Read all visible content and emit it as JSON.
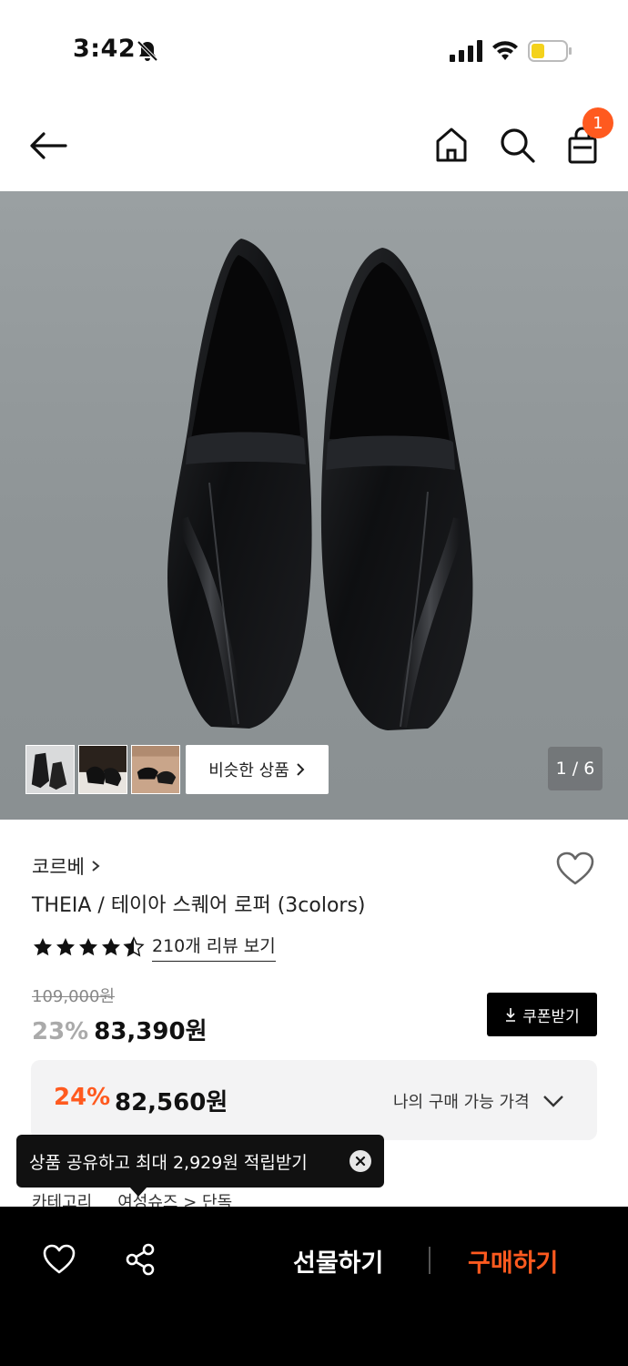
{
  "status": {
    "time": "3:42"
  },
  "header": {
    "cart_count": "1"
  },
  "gallery": {
    "similar_label": "비슷한 상품",
    "page_indicator": "1 / 6"
  },
  "product": {
    "brand": "코르베",
    "name": "THEIA / 테이아 스퀘어 로퍼 (3colors)",
    "rating": 4.5,
    "review_link": "210개 리뷰 보기",
    "original_price": "109,000원",
    "discount": "23%",
    "sale_price": "83,390원",
    "coupon_label": "쿠폰받기"
  },
  "my_price": {
    "discount": "24%",
    "price": "82,560원",
    "label": "나의 구매 가능 가격"
  },
  "category": {
    "label": "카테고리",
    "path": "여성슈즈 > 단독"
  },
  "tooltip": {
    "text": "상품 공유하고 최대 2,929원 적립받기"
  },
  "bottom_bar": {
    "gift_label": "선물하기",
    "buy_label": "구매하기"
  },
  "colors": {
    "accent": "#ff5a1f",
    "black": "#000000"
  }
}
